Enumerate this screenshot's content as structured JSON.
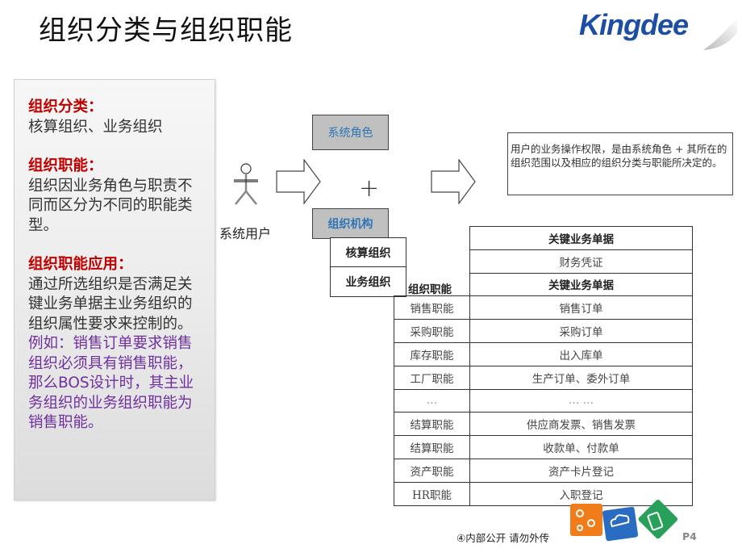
{
  "header": {
    "title": "组织分类与组织职能",
    "logo": "Kingdee"
  },
  "left_panel": {
    "sections": [
      {
        "heading": "组织分类：",
        "body": "核算组织、业务组织"
      },
      {
        "heading": "组织职能：",
        "body": "组织因业务角色与职责不同而区分为不同的职能类型。"
      },
      {
        "heading": "组织职能应用：",
        "body": "通过所选组织是否满足关键业务单据主业务组织的组织属性要求来控制的。",
        "example": "例如：销售订单要求销售组织必须具有销售职能，那么BOS设计时，其主业务组织的业务组织职能为销售职能。"
      }
    ]
  },
  "diagram": {
    "user_label": "系统用户",
    "role_box": "系统角色",
    "org_box": "组织机构",
    "plus": "+",
    "org_types": [
      "核算组织",
      "业务组织"
    ],
    "note": "用户的业务操作权限，是由系统角色 + 其所在的组织范围以及相应的组织分类与职能所决定的。",
    "icons": {
      "user": "stick-figure-icon",
      "arrow": "block-arrow-right-icon"
    }
  },
  "table": {
    "accounting_header": "关键业务单据",
    "accounting_row": "财务凭证",
    "func_header": "组织职能",
    "doc_header": "关键业务单据",
    "rows": [
      {
        "func": "销售职能",
        "doc": "销售订单"
      },
      {
        "func": "采购职能",
        "doc": "采购订单"
      },
      {
        "func": "库存职能",
        "doc": "出入库单"
      },
      {
        "func": "工厂职能",
        "doc": "生产订单、委外订单"
      },
      {
        "func": "…",
        "doc": "… …"
      },
      {
        "func": "结算职能",
        "doc": "供应商发票、销售发票"
      },
      {
        "func": "结算职能",
        "doc": "收款单、付款单"
      },
      {
        "func": "资产职能",
        "doc": "资产卡片登记"
      },
      {
        "func": "HR职能",
        "doc": "入职登记"
      }
    ]
  },
  "footer": {
    "confidential": "④内部公开 请勿外传",
    "page": "P4"
  }
}
